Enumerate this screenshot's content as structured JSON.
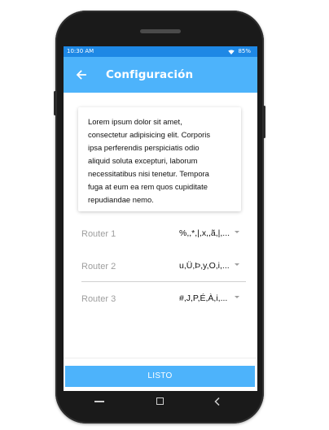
{
  "status_bar": {
    "time": "10:30 AM",
    "battery": "85%",
    "wifi_icon": "wifi-icon"
  },
  "app_bar": {
    "title": "Configuración",
    "back_icon": "arrow-back-icon"
  },
  "description": {
    "lines": [
      "Lorem ipsum dolor sit amet,",
      "consectetur adipisicing elit. Corporis",
      "ipsa perferendis perspiciatis odio",
      "aliquid soluta excepturi, laborum",
      "necessitatibus nisi tenetur. Tempora",
      "fuga at eum ea rem quos cupiditate",
      "repudiandae nemo."
    ]
  },
  "routers": [
    {
      "label": "Router 1",
      "value": "%,,*,|,x,,ã,|,..."
    },
    {
      "label": "Router 2",
      "value": "u,Ü,Þ,y,O,i,..."
    },
    {
      "label": "Router 3",
      "value": "#,J,P,É,À,i,..."
    }
  ],
  "footer": {
    "button_label": "LISTO"
  },
  "nav": {
    "menu_icon": "menu-icon",
    "home_icon": "home-square-icon",
    "back_icon": "back-triangle-icon"
  },
  "colors": {
    "status_bar": "#1e88e5",
    "primary": "#4db3fb",
    "phone_body": "#1a1a1a"
  }
}
